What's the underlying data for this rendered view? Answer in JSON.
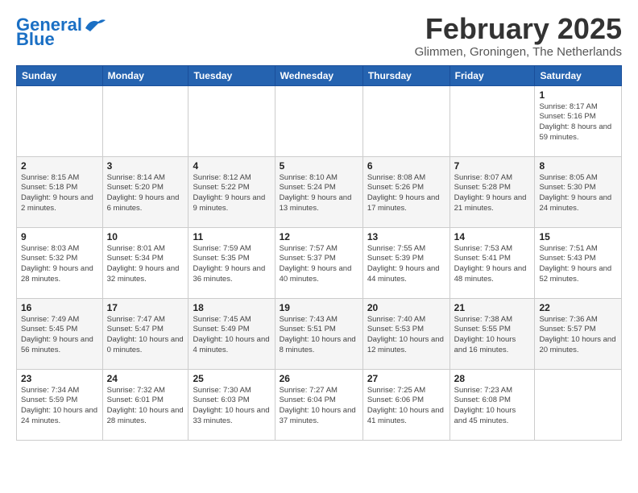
{
  "header": {
    "logo_line1": "General",
    "logo_line2": "Blue",
    "month_title": "February 2025",
    "subtitle": "Glimmen, Groningen, The Netherlands"
  },
  "weekdays": [
    "Sunday",
    "Monday",
    "Tuesday",
    "Wednesday",
    "Thursday",
    "Friday",
    "Saturday"
  ],
  "weeks": [
    [
      {
        "day": "",
        "info": ""
      },
      {
        "day": "",
        "info": ""
      },
      {
        "day": "",
        "info": ""
      },
      {
        "day": "",
        "info": ""
      },
      {
        "day": "",
        "info": ""
      },
      {
        "day": "",
        "info": ""
      },
      {
        "day": "1",
        "info": "Sunrise: 8:17 AM\nSunset: 5:16 PM\nDaylight: 8 hours and 59 minutes."
      }
    ],
    [
      {
        "day": "2",
        "info": "Sunrise: 8:15 AM\nSunset: 5:18 PM\nDaylight: 9 hours and 2 minutes."
      },
      {
        "day": "3",
        "info": "Sunrise: 8:14 AM\nSunset: 5:20 PM\nDaylight: 9 hours and 6 minutes."
      },
      {
        "day": "4",
        "info": "Sunrise: 8:12 AM\nSunset: 5:22 PM\nDaylight: 9 hours and 9 minutes."
      },
      {
        "day": "5",
        "info": "Sunrise: 8:10 AM\nSunset: 5:24 PM\nDaylight: 9 hours and 13 minutes."
      },
      {
        "day": "6",
        "info": "Sunrise: 8:08 AM\nSunset: 5:26 PM\nDaylight: 9 hours and 17 minutes."
      },
      {
        "day": "7",
        "info": "Sunrise: 8:07 AM\nSunset: 5:28 PM\nDaylight: 9 hours and 21 minutes."
      },
      {
        "day": "8",
        "info": "Sunrise: 8:05 AM\nSunset: 5:30 PM\nDaylight: 9 hours and 24 minutes."
      }
    ],
    [
      {
        "day": "9",
        "info": "Sunrise: 8:03 AM\nSunset: 5:32 PM\nDaylight: 9 hours and 28 minutes."
      },
      {
        "day": "10",
        "info": "Sunrise: 8:01 AM\nSunset: 5:34 PM\nDaylight: 9 hours and 32 minutes."
      },
      {
        "day": "11",
        "info": "Sunrise: 7:59 AM\nSunset: 5:35 PM\nDaylight: 9 hours and 36 minutes."
      },
      {
        "day": "12",
        "info": "Sunrise: 7:57 AM\nSunset: 5:37 PM\nDaylight: 9 hours and 40 minutes."
      },
      {
        "day": "13",
        "info": "Sunrise: 7:55 AM\nSunset: 5:39 PM\nDaylight: 9 hours and 44 minutes."
      },
      {
        "day": "14",
        "info": "Sunrise: 7:53 AM\nSunset: 5:41 PM\nDaylight: 9 hours and 48 minutes."
      },
      {
        "day": "15",
        "info": "Sunrise: 7:51 AM\nSunset: 5:43 PM\nDaylight: 9 hours and 52 minutes."
      }
    ],
    [
      {
        "day": "16",
        "info": "Sunrise: 7:49 AM\nSunset: 5:45 PM\nDaylight: 9 hours and 56 minutes."
      },
      {
        "day": "17",
        "info": "Sunrise: 7:47 AM\nSunset: 5:47 PM\nDaylight: 10 hours and 0 minutes."
      },
      {
        "day": "18",
        "info": "Sunrise: 7:45 AM\nSunset: 5:49 PM\nDaylight: 10 hours and 4 minutes."
      },
      {
        "day": "19",
        "info": "Sunrise: 7:43 AM\nSunset: 5:51 PM\nDaylight: 10 hours and 8 minutes."
      },
      {
        "day": "20",
        "info": "Sunrise: 7:40 AM\nSunset: 5:53 PM\nDaylight: 10 hours and 12 minutes."
      },
      {
        "day": "21",
        "info": "Sunrise: 7:38 AM\nSunset: 5:55 PM\nDaylight: 10 hours and 16 minutes."
      },
      {
        "day": "22",
        "info": "Sunrise: 7:36 AM\nSunset: 5:57 PM\nDaylight: 10 hours and 20 minutes."
      }
    ],
    [
      {
        "day": "23",
        "info": "Sunrise: 7:34 AM\nSunset: 5:59 PM\nDaylight: 10 hours and 24 minutes."
      },
      {
        "day": "24",
        "info": "Sunrise: 7:32 AM\nSunset: 6:01 PM\nDaylight: 10 hours and 28 minutes."
      },
      {
        "day": "25",
        "info": "Sunrise: 7:30 AM\nSunset: 6:03 PM\nDaylight: 10 hours and 33 minutes."
      },
      {
        "day": "26",
        "info": "Sunrise: 7:27 AM\nSunset: 6:04 PM\nDaylight: 10 hours and 37 minutes."
      },
      {
        "day": "27",
        "info": "Sunrise: 7:25 AM\nSunset: 6:06 PM\nDaylight: 10 hours and 41 minutes."
      },
      {
        "day": "28",
        "info": "Sunrise: 7:23 AM\nSunset: 6:08 PM\nDaylight: 10 hours and 45 minutes."
      },
      {
        "day": "",
        "info": ""
      }
    ]
  ]
}
